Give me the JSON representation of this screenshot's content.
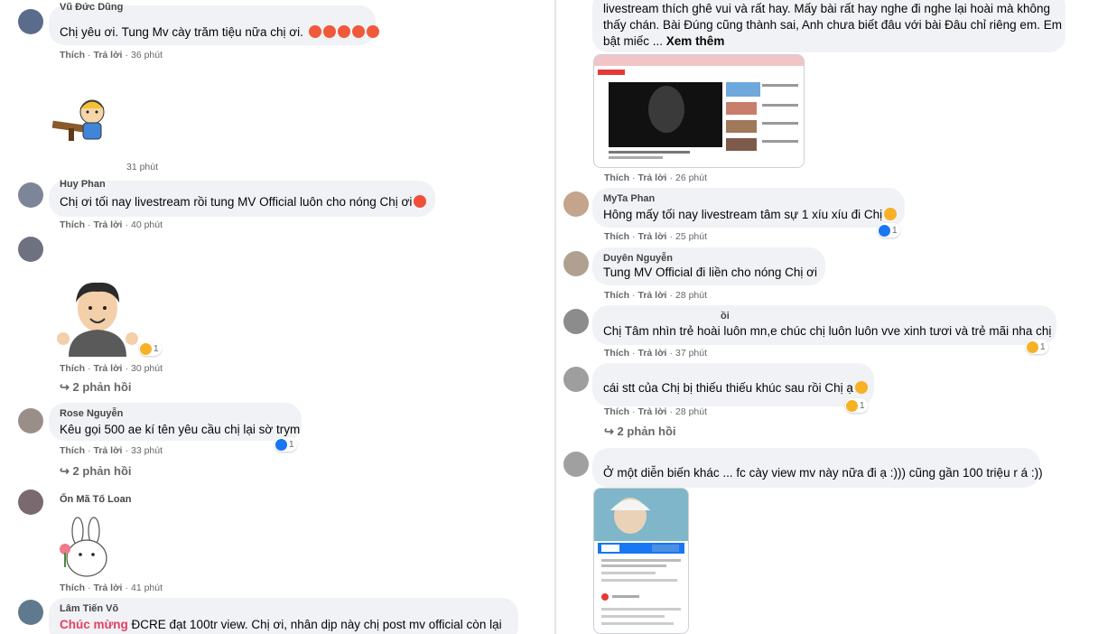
{
  "left": {
    "c1": {
      "author": "Vũ Đức Dũng",
      "text": "Chị yêu ơi. Tung Mv cày trăm tiệu nữa chị ơi.",
      "like": "Thích",
      "reply": "Trả lời",
      "time": "36 phút"
    },
    "c2": {
      "time": "31 phút"
    },
    "c3": {
      "author": "Huy Phan",
      "text": "Chị ơi tối nay livestream rồi tung MV Official luôn cho nóng Chị ơi",
      "like": "Thích",
      "reply": "Trả lời",
      "time": "40 phút"
    },
    "c4": {
      "like": "Thích",
      "reply": "Trả lời",
      "time": "30 phút",
      "react_count": "1",
      "replies": "2 phản hồi"
    },
    "c5": {
      "author": "Rose Nguyễn",
      "text": "Kêu gọi 500 ae kí tên yêu cầu chị lại sờ trym",
      "like": "Thích",
      "reply": "Trả lời",
      "time": "33 phút",
      "react_count": "1",
      "replies": "2 phản hồi"
    },
    "c6": {
      "author": "Ốn Mã Tố Loan",
      "like": "Thích",
      "reply": "Trả lời",
      "time": "41 phút"
    },
    "c7": {
      "author": "Lâm Tiến Võ",
      "highlight": "Chúc mừng",
      "text": " ĐCRE đạt 100tr view. Chị ơi, nhân dịp này chị post mv official còn lại"
    }
  },
  "right": {
    "r0": {
      "line1": "livestream thích ghê vui và rất hay. Mấy bài rất hay nghe đi nghe lại hoài mà không",
      "line2": "thấy chán. Bài Đúng cũng thành sai, Anh chưa biết đâu với bài Đâu chỉ riêng em. Em",
      "line3": "bật miếc ...",
      "see_more": "Xem thêm",
      "like": "Thích",
      "reply": "Trả lời",
      "time": "26 phút"
    },
    "r1": {
      "author": "MyTa Phan",
      "text": "Hông mấy tối nay livestream tâm sự 1 xíu xíu đi Chị",
      "like": "Thích",
      "reply": "Trả lời",
      "time": "25 phút",
      "react_count": "1"
    },
    "r2": {
      "author": "Duyên Nguyễn",
      "text": "Tung MV Official đi liền cho nóng Chị ơi",
      "like": "Thích",
      "reply": "Trả lời",
      "time": "28 phút"
    },
    "r3": {
      "author": "ồi",
      "text": "Chị Tâm nhìn trẻ hoài luôn mn,e chúc chị luôn luôn vve xinh tươi và trẻ mãi nha chị",
      "like": "Thích",
      "reply": "Trả lời",
      "time": "37 phút",
      "react_count": "1"
    },
    "r4": {
      "text": "cái stt của Chị bị thiếu thiếu khúc sau rồi Chị ạ",
      "like": "Thích",
      "reply": "Trả lời",
      "time": "28 phút",
      "react_count": "1",
      "replies": "2 phản hồi"
    },
    "r5": {
      "text": "Ở một diễn biến khác ... fc cày view mv này nữa đi ạ :))) cũng gần 100 triệu r á :))"
    }
  },
  "colors": {
    "bubble": "#f0f2f5",
    "meta": "#65676b",
    "link": "#050505",
    "highlight": "#e4405f",
    "like": "#1877f2"
  },
  "icons": [
    "reply-arrow-icon",
    "haha-reaction-icon",
    "like-reaction-icon",
    "love-emoji-icon"
  ]
}
